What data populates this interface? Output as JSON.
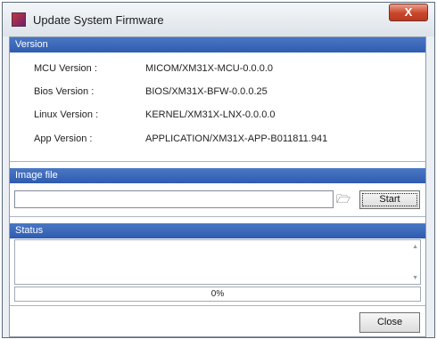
{
  "window": {
    "title": "Update System Firmware",
    "close_glyph": "X",
    "app_icon": "firmware-app-icon"
  },
  "version": {
    "header": "Version",
    "rows": [
      {
        "label": "MCU Version :",
        "value": "MICOM/XM31X-MCU-0.0.0.0"
      },
      {
        "label": "Bios Version :",
        "value": "BIOS/XM31X-BFW-0.0.0.25"
      },
      {
        "label": "Linux Version :",
        "value": "KERNEL/XM31X-LNX-0.0.0.0"
      },
      {
        "label": "App Version :",
        "value": "APPLICATION/XM31X-APP-B011811.941"
      }
    ]
  },
  "image_file": {
    "header": "Image file",
    "value": "",
    "browse_icon": "folder-open-icon",
    "browse_glyph": "🗁",
    "start_label": "Start"
  },
  "status": {
    "header": "Status",
    "log_text": "",
    "progress_text": "0%",
    "progress_value": 0
  },
  "footer": {
    "close_label": "Close"
  },
  "colors": {
    "header_bg": "#3766b8",
    "close_button": "#c9452a"
  }
}
